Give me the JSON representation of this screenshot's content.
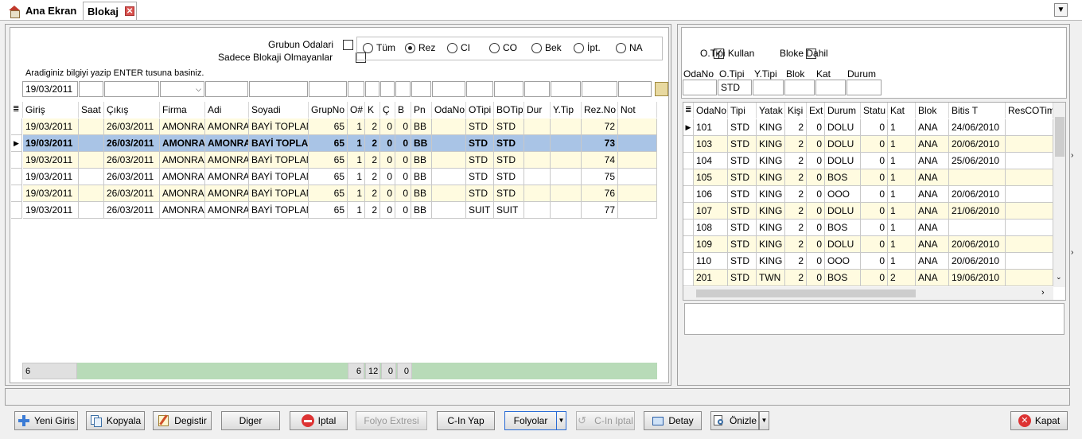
{
  "tabs": [
    {
      "label": "Ana Ekran",
      "icon": "home-icon"
    },
    {
      "label": "Blokaj",
      "icon": "close-icon"
    }
  ],
  "filters": {
    "grubun_odalari": {
      "label": "Grubun Odalari",
      "checked": false
    },
    "sadece_blokaji": {
      "label": "Sadece Blokaji Olmayanlar",
      "checked": false
    },
    "radios": [
      "Tüm",
      "Rez",
      "CI",
      "CO",
      "Bek",
      "İpt.",
      "NA"
    ],
    "radio_selected": "Rez",
    "hint": "Aradiginiz bilgiyi yazip ENTER tusuna basiniz.",
    "date_value": "19/03/2011"
  },
  "left_grid": {
    "columns": [
      "Giriş",
      "Saat",
      "Çıkış",
      "Firma",
      "Adi",
      "Soyadi",
      "GrupNo",
      "O#",
      "K",
      "Ç",
      "B",
      "Pn",
      "OdaNo",
      "OTipi",
      "BOTipi",
      "Dur",
      "Y.Tip",
      "Rez.No",
      "Not"
    ],
    "rows": [
      [
        "19/03/2011",
        "",
        "26/03/2011",
        "AMONRA",
        "AMONRA",
        "BAYİ TOPLANTISI",
        "65",
        "1",
        "2",
        "0",
        "0",
        "BB",
        "",
        "STD",
        "STD",
        "",
        "",
        "72",
        ""
      ],
      [
        "19/03/2011",
        "",
        "26/03/2011",
        "AMONRA",
        "AMONRA",
        "BAYİ TOPLANTISI",
        "65",
        "1",
        "2",
        "0",
        "0",
        "BB",
        "",
        "STD",
        "STD",
        "",
        "",
        "73",
        ""
      ],
      [
        "19/03/2011",
        "",
        "26/03/2011",
        "AMONRA",
        "AMONRA",
        "BAYİ TOPLANTISI",
        "65",
        "1",
        "2",
        "0",
        "0",
        "BB",
        "",
        "STD",
        "STD",
        "",
        "",
        "74",
        ""
      ],
      [
        "19/03/2011",
        "",
        "26/03/2011",
        "AMONRA",
        "AMONRA",
        "BAYİ TOPLANTISI",
        "65",
        "1",
        "2",
        "0",
        "0",
        "BB",
        "",
        "STD",
        "STD",
        "",
        "",
        "75",
        ""
      ],
      [
        "19/03/2011",
        "",
        "26/03/2011",
        "AMONRA",
        "AMONRA",
        "BAYİ TOPLANTISI",
        "65",
        "1",
        "2",
        "0",
        "0",
        "BB",
        "",
        "STD",
        "STD",
        "",
        "",
        "76",
        ""
      ],
      [
        "19/03/2011",
        "",
        "26/03/2011",
        "AMONRA",
        "AMONRA",
        "BAYİ TOPLANTISI",
        "65",
        "1",
        "2",
        "0",
        "0",
        "BB",
        "",
        "SUIT",
        "SUIT",
        "",
        "",
        "77",
        ""
      ]
    ],
    "selected_row": 1,
    "footer": {
      "count": "6",
      "o_sum": "6",
      "k_sum": "12",
      "c_sum": "0",
      "b_sum": "0"
    }
  },
  "right_filters": {
    "otipi_kullan": {
      "label": "O.Tipi Kullan",
      "checked": true
    },
    "bloke_dahil": {
      "label": "Bloke Dahil",
      "checked": false
    },
    "field_labels": [
      "OdaNo",
      "O.Tipi",
      "Y.Tipi",
      "Blok",
      "Kat",
      "Durum"
    ],
    "otipi_value": "STD"
  },
  "right_grid": {
    "columns": [
      "OdaNo",
      "Tipi",
      "Yatak",
      "Kişi",
      "Ext",
      "Durum",
      "Statu",
      "Kat",
      "Blok",
      "Bitis T",
      "ResCOTime"
    ],
    "rows": [
      [
        "101",
        "STD",
        "KING",
        "2",
        "0",
        "DOLU",
        "0",
        "1",
        "ANA",
        "24/06/2010",
        ""
      ],
      [
        "103",
        "STD",
        "KING",
        "2",
        "0",
        "DOLU",
        "0",
        "1",
        "ANA",
        "20/06/2010",
        ""
      ],
      [
        "104",
        "STD",
        "KING",
        "2",
        "0",
        "DOLU",
        "0",
        "1",
        "ANA",
        "25/06/2010",
        ""
      ],
      [
        "105",
        "STD",
        "KING",
        "2",
        "0",
        "BOS",
        "0",
        "1",
        "ANA",
        "",
        ""
      ],
      [
        "106",
        "STD",
        "KING",
        "2",
        "0",
        "OOO",
        "0",
        "1",
        "ANA",
        "20/06/2010",
        ""
      ],
      [
        "107",
        "STD",
        "KING",
        "2",
        "0",
        "DOLU",
        "0",
        "1",
        "ANA",
        "21/06/2010",
        ""
      ],
      [
        "108",
        "STD",
        "KING",
        "2",
        "0",
        "BOS",
        "0",
        "1",
        "ANA",
        "",
        ""
      ],
      [
        "109",
        "STD",
        "KING",
        "2",
        "0",
        "DOLU",
        "0",
        "1",
        "ANA",
        "20/06/2010",
        ""
      ],
      [
        "110",
        "STD",
        "KING",
        "2",
        "0",
        "OOO",
        "0",
        "1",
        "ANA",
        "20/06/2010",
        ""
      ],
      [
        "201",
        "STD",
        "TWN",
        "2",
        "0",
        "BOS",
        "0",
        "2",
        "ANA",
        "19/06/2010",
        ""
      ]
    ]
  },
  "toolbar": {
    "yeni_giris": "Yeni Giris",
    "kopyala": "Kopyala",
    "degistir": "Degistir",
    "diger": "Diger",
    "iptal": "Iptal",
    "folyo_extresi": "Folyo Extresi",
    "cin_yap": "C-In Yap",
    "folyolar": "Folyolar",
    "cin_iptal": "C-In Iptal",
    "detay": "Detay",
    "onizle": "Önizle",
    "kapat": "Kapat"
  }
}
